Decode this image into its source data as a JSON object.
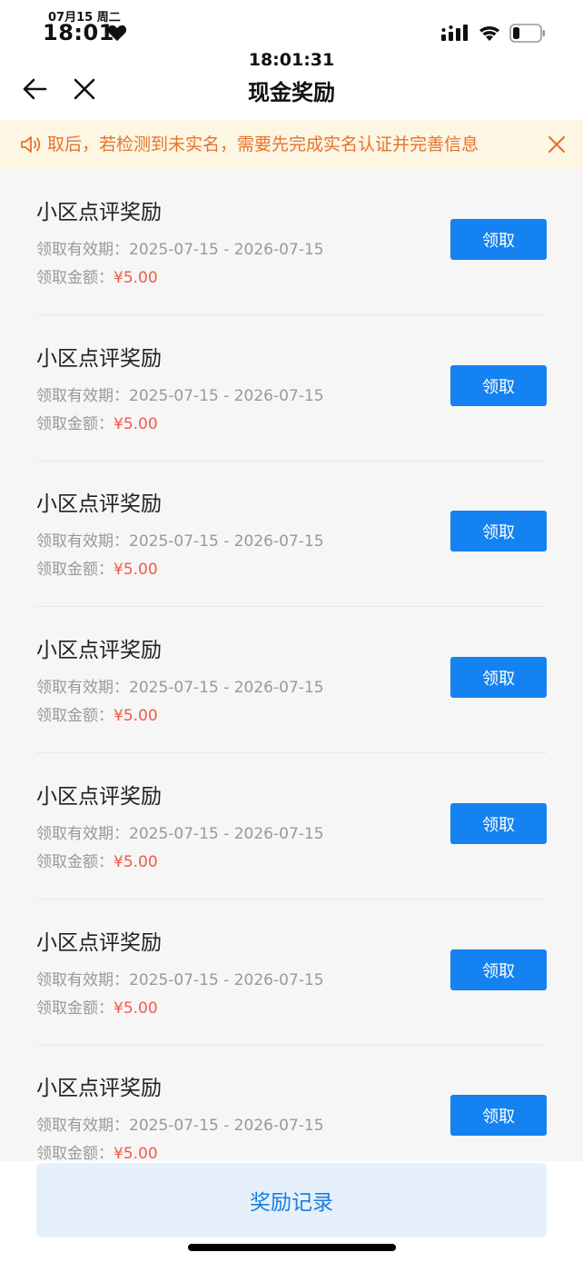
{
  "status_bar": {
    "date": "07月15 周二",
    "time": "18:01"
  },
  "nav": {
    "clock": "18:01:31",
    "title": "现金奖励"
  },
  "notice": {
    "text": "取后，若检测到未实名，需要先完成实名认证并完善信息"
  },
  "rewards": [
    {
      "title": "小区点评奖励",
      "period": "领取有效期：2025-07-15 - 2026-07-15",
      "amount_label": "领取金额：",
      "amount": "¥5.00",
      "button": "领取"
    },
    {
      "title": "小区点评奖励",
      "period": "领取有效期：2025-07-15 - 2026-07-15",
      "amount_label": "领取金额：",
      "amount": "¥5.00",
      "button": "领取"
    },
    {
      "title": "小区点评奖励",
      "period": "领取有效期：2025-07-15 - 2026-07-15",
      "amount_label": "领取金额：",
      "amount": "¥5.00",
      "button": "领取"
    },
    {
      "title": "小区点评奖励",
      "period": "领取有效期：2025-07-15 - 2026-07-15",
      "amount_label": "领取金额：",
      "amount": "¥5.00",
      "button": "领取"
    },
    {
      "title": "小区点评奖励",
      "period": "领取有效期：2025-07-15 - 2026-07-15",
      "amount_label": "领取金额：",
      "amount": "¥5.00",
      "button": "领取"
    },
    {
      "title": "小区点评奖励",
      "period": "领取有效期：2025-07-15 - 2026-07-15",
      "amount_label": "领取金额：",
      "amount": "¥5.00",
      "button": "领取"
    },
    {
      "title": "小区点评奖励",
      "period": "领取有效期：2025-07-15 - 2026-07-15",
      "amount_label": "领取金额：",
      "amount": "¥5.00",
      "button": "领取"
    }
  ],
  "bottom": {
    "record_button": "奖励记录"
  },
  "colors": {
    "primary": "#1482f0",
    "amount": "#f05a4a",
    "notice_text": "#e8732c",
    "notice_bg": "#fdf6e3"
  }
}
